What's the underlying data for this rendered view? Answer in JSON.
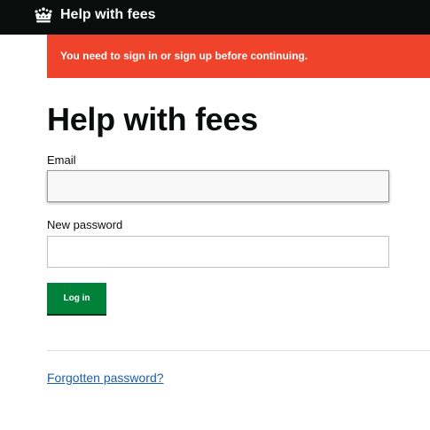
{
  "header": {
    "logo_icon": "crown-icon",
    "title": "Help with fees"
  },
  "flash": {
    "message": "You need to sign in or sign up before continuing.",
    "color": "#f0432b"
  },
  "page": {
    "title": "Help with fees"
  },
  "form": {
    "email_label": "Email",
    "email_value": "",
    "password_label": "New password",
    "password_value": "",
    "submit_label": "Log in",
    "submit_color": "#00823b"
  },
  "footer": {
    "forgot_link": "Forgotten password?"
  }
}
